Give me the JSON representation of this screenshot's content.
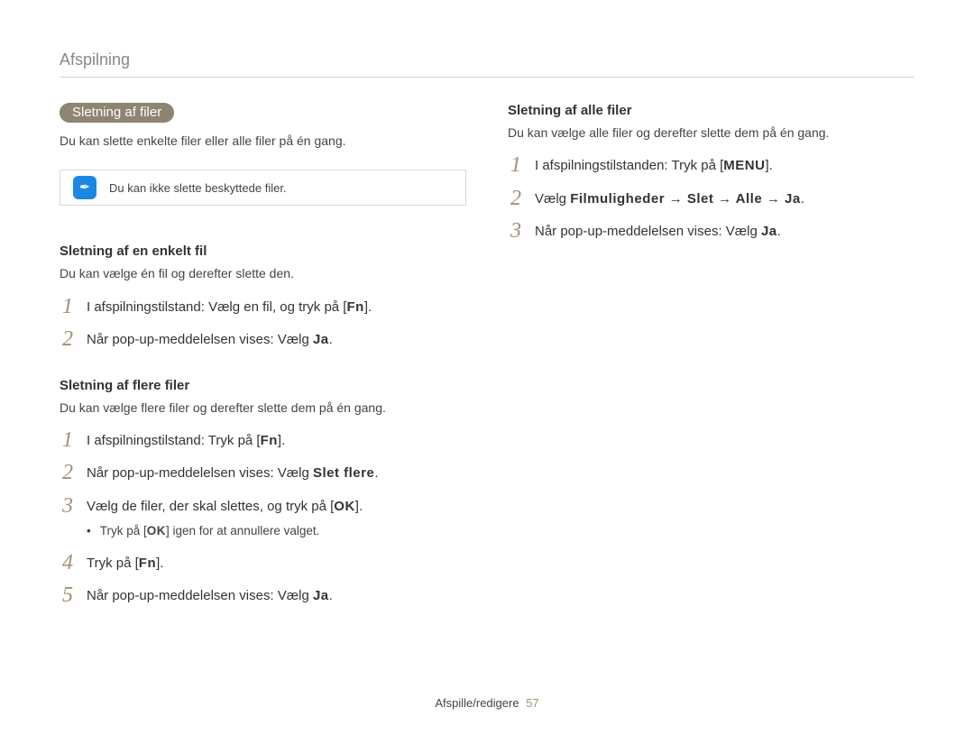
{
  "header": "Afspilning",
  "pill": "Sletning af filer",
  "pill_intro": "Du kan slette enkelte filer eller alle filer på én gang.",
  "note_text": "Du kan ikke slette beskyttede filer.",
  "sec1_head": "Sletning af en enkelt fil",
  "sec1_intro": "Du kan vælge én fil og derefter slette den.",
  "sec1_steps": [
    {
      "n": "1",
      "pre": "I afspilningstilstand: Vælg en fil, og tryk på [",
      "key": "Fn",
      "post": "]."
    },
    {
      "n": "2",
      "pre": "Når pop-up-meddelelsen vises: Vælg ",
      "key": "Ja",
      "post": "."
    }
  ],
  "sec2_head": "Sletning af flere filer",
  "sec2_intro": "Du kan vælge flere filer og derefter slette dem på én gang.",
  "sec2_steps": [
    {
      "n": "1",
      "pre": "I afspilningstilstand: Tryk på [",
      "key": "Fn",
      "post": "]."
    },
    {
      "n": "2",
      "pre": "Når pop-up-meddelelsen vises: Vælg ",
      "key": "Slet flere",
      "post": "."
    },
    {
      "n": "3",
      "pre": "Vælg de filer, der skal slettes, og tryk på [",
      "key": "OK",
      "post": "]."
    },
    {
      "n": "4",
      "pre": "Tryk på [",
      "key": "Fn",
      "post": "]."
    },
    {
      "n": "5",
      "pre": "Når pop-up-meddelelsen vises: Vælg ",
      "key": "Ja",
      "post": "."
    }
  ],
  "sec2_bullet_pre": "Tryk på [",
  "sec2_bullet_key": "OK",
  "sec2_bullet_post": "] igen for at annullere valget.",
  "sec3_head": "Sletning af alle filer",
  "sec3_intro": "Du kan vælge alle filer og derefter slette dem på én gang.",
  "sec3_steps": [
    {
      "n": "1",
      "pre": "I afspilningstilstanden: Tryk på [",
      "key": "MENU",
      "post": "]."
    },
    {
      "n": "2",
      "pre": "Vælg ",
      "key": "Filmuligheder → Slet → Alle → Ja",
      "post": "."
    },
    {
      "n": "3",
      "pre": "Når pop-up-meddelelsen vises: Vælg ",
      "key": "Ja",
      "post": "."
    }
  ],
  "footer_label": "Afspille/redigere",
  "footer_page": "57"
}
